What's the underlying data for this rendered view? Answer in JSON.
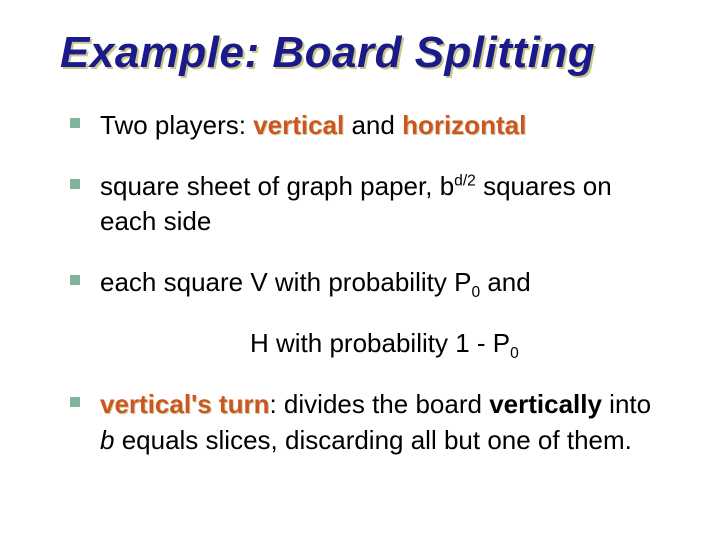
{
  "title": "Example: Board Splitting",
  "bullets": {
    "b1_prefix": "Two players: ",
    "b1_vertical": "vertical",
    "b1_and": " and ",
    "b1_horizontal": "horizontal",
    "b2_prefix": "square sheet of graph paper, b",
    "b2_exp": "d/2",
    "b2_suffix": "  squares on each side",
    "b3_prefix": "each square V with probability P",
    "b3_sub0": "0",
    "b3_suffix": "  and",
    "b3_line2_prefix": "H with probability 1 - P",
    "b3_line2_sub": "0",
    "b4_vturn": "vertical's turn",
    "b4_colon": ": divides the board ",
    "b4_vertically": "vertically",
    "b4_into": " into ",
    "b4_b": "b",
    "b4_rest": " equals slices, discarding all but one of them."
  }
}
